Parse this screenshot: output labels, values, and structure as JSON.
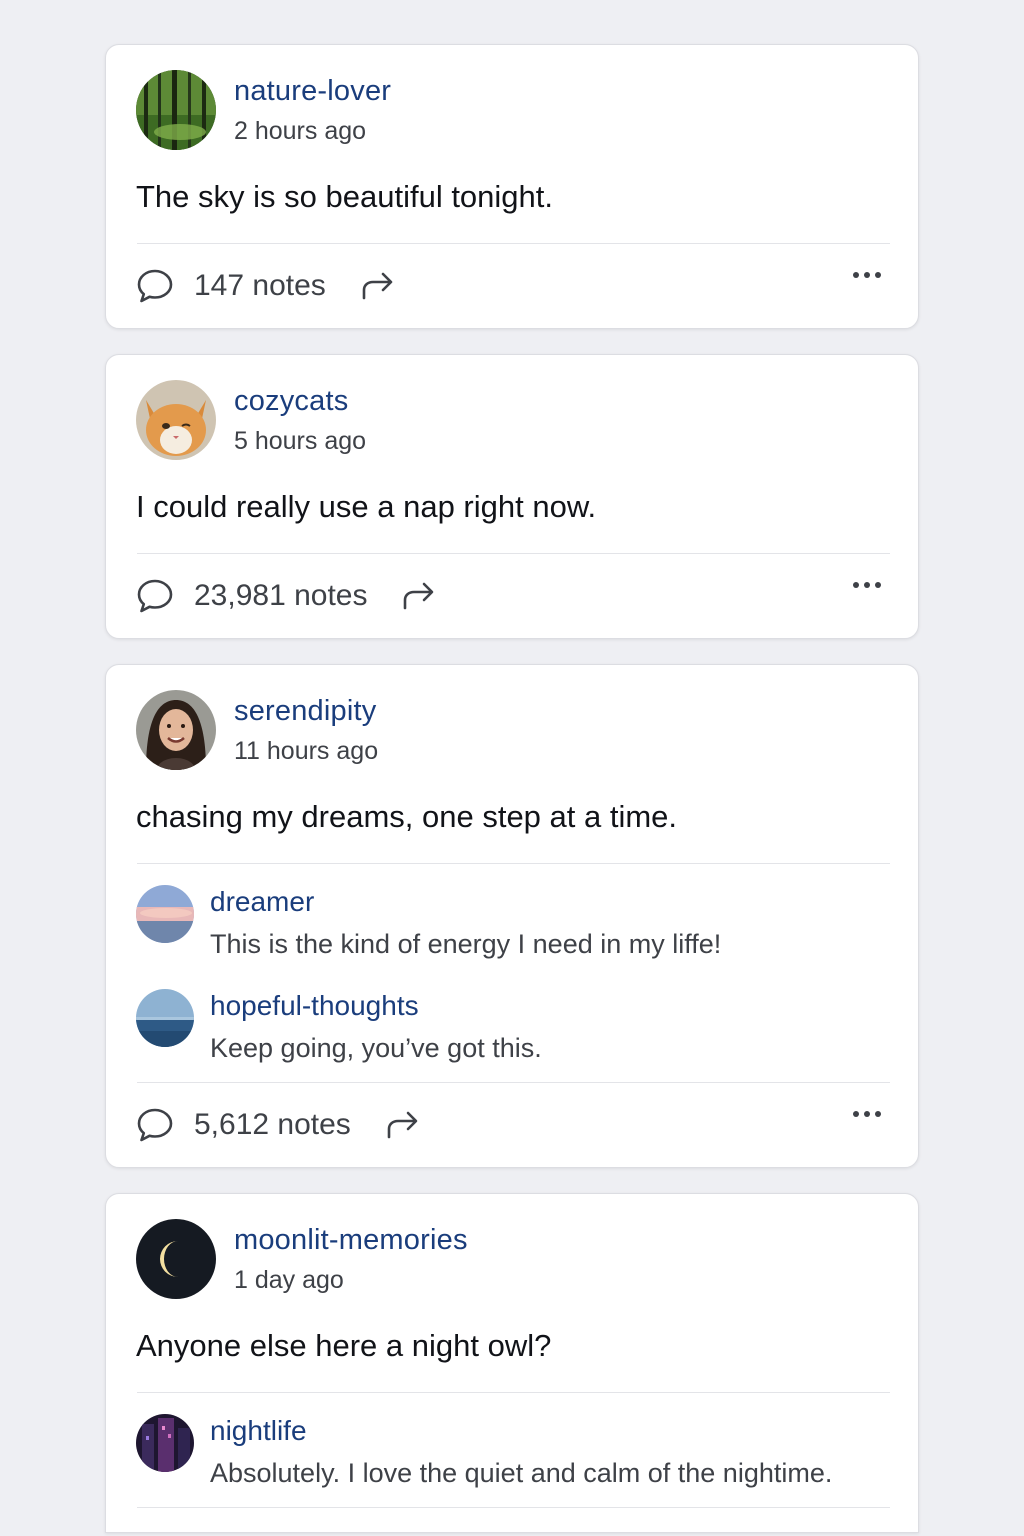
{
  "posts": [
    {
      "username": "nature-lover",
      "time": "2 hours ago",
      "text": "The sky is so beautiful tonight.",
      "notes": "147 notes",
      "avatar": "forest-avatar"
    },
    {
      "username": "cozycats",
      "time": "5 hours ago",
      "text": "I could really use a nap right now.",
      "notes": "23,981 notes",
      "avatar": "cat-avatar"
    },
    {
      "username": "serendipity",
      "time": "11 hours ago",
      "text": "chasing my dreams, one step at a time.",
      "notes": "5,612 notes",
      "avatar": "woman-avatar",
      "replies": [
        {
          "username": "dreamer",
          "text": "This is the kind of energy I need in my liffe!",
          "avatar": "sunset-sky-avatar"
        },
        {
          "username": "hopeful-thoughts",
          "text": "Keep going, you’ve got this.",
          "avatar": "ocean-avatar"
        }
      ]
    },
    {
      "username": "moonlit-memories",
      "time": "1 day ago",
      "text": "Anyone else here a night owl?",
      "avatar": "moon-avatar",
      "replies": [
        {
          "username": "nightlife",
          "text": "Absolutely. I love the quiet and calm of the nightime.",
          "avatar": "night-city-avatar"
        }
      ]
    }
  ],
  "colors": {
    "background": "#eeeff3",
    "username": "#1a3d7c",
    "text": "#111318",
    "muted": "#3e4147"
  },
  "icons": [
    "comment-icon",
    "share-icon",
    "more-icon"
  ]
}
